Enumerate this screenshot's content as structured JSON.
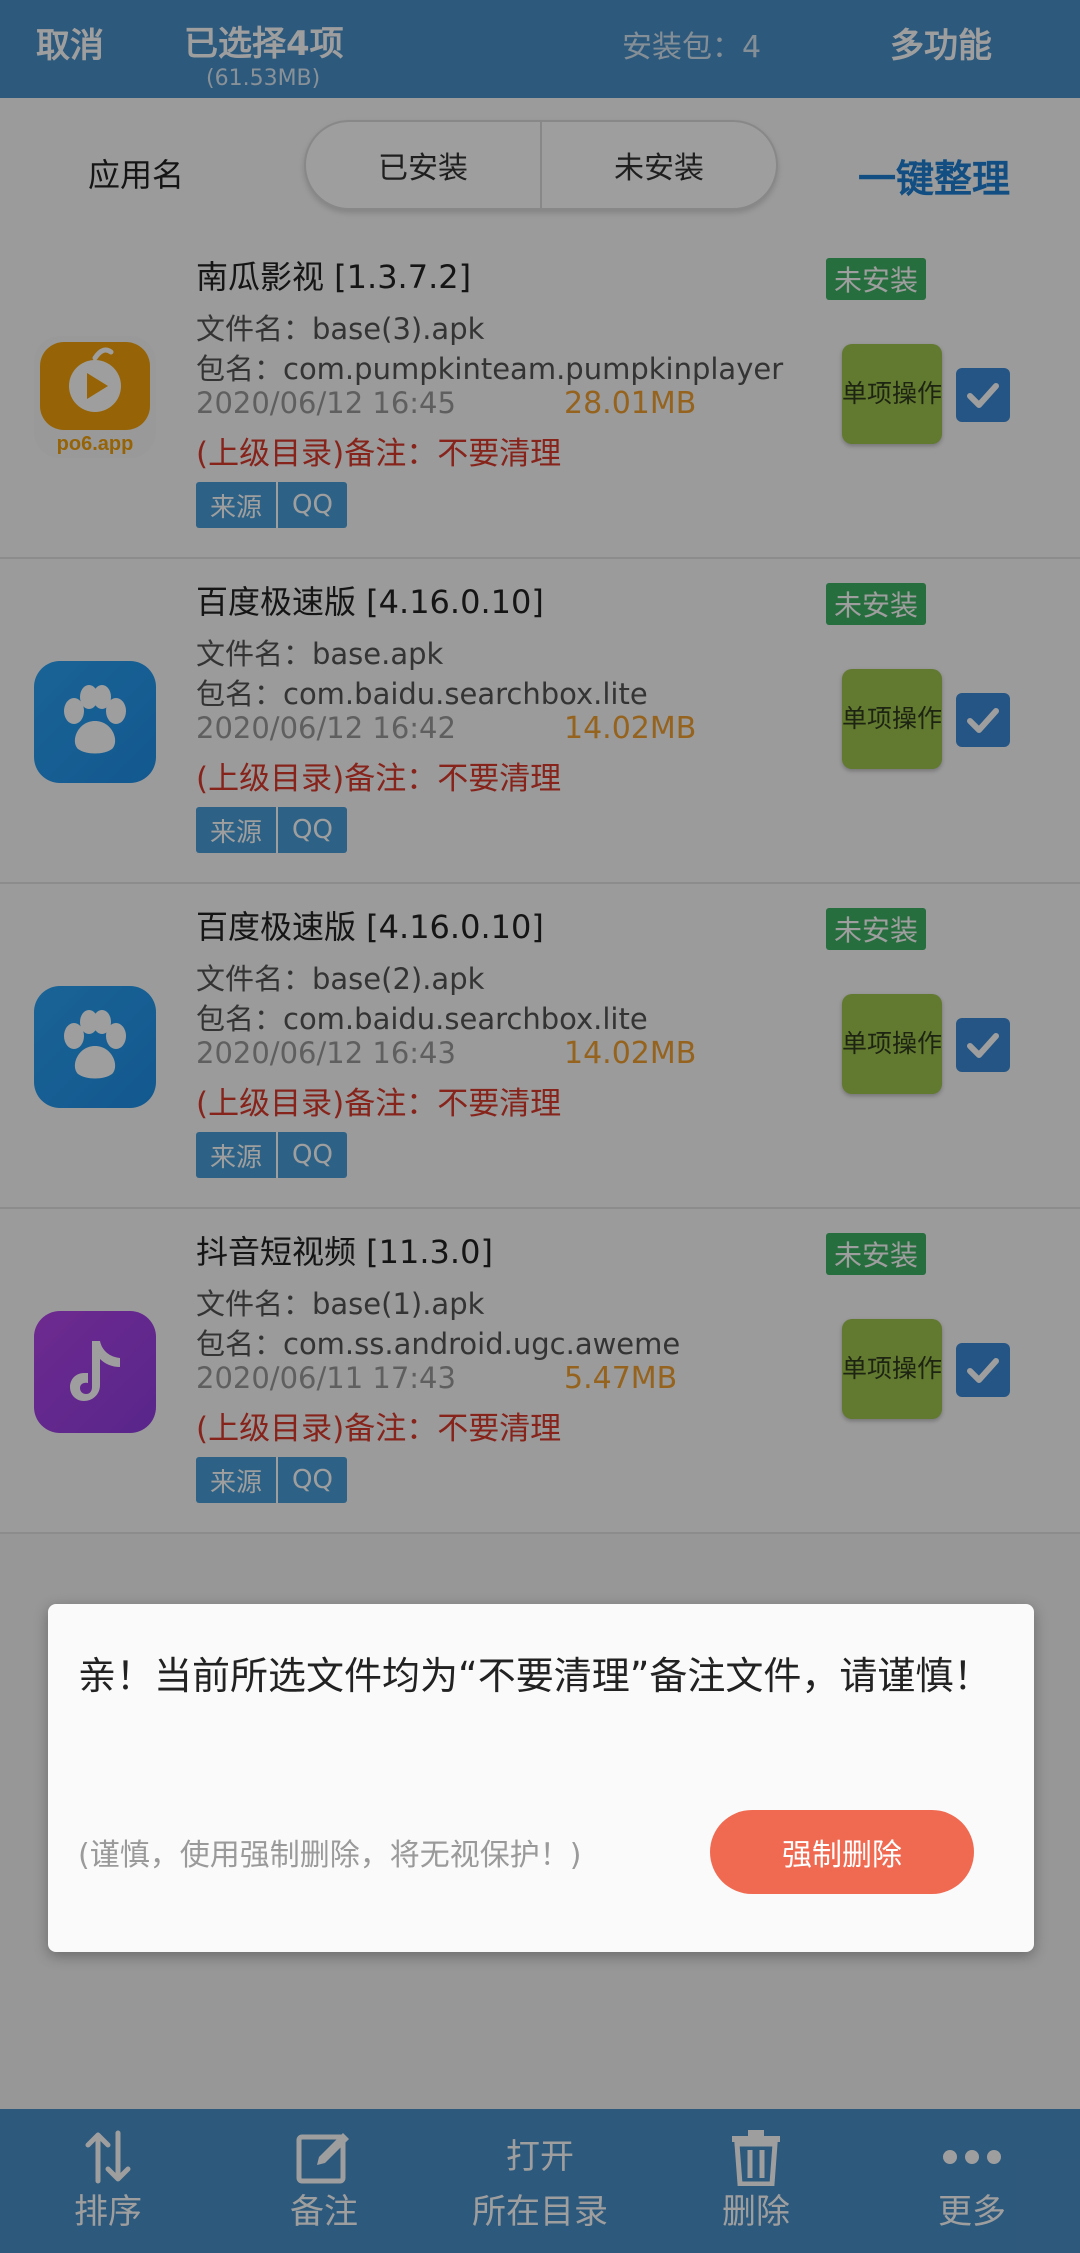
{
  "topbar": {
    "cancel": "取消",
    "selected": "已选择4项",
    "selected_size": "(61.53MB)",
    "package_count": "安装包：4",
    "multi_function": "多功能"
  },
  "filter": {
    "app_name_label": "应用名",
    "tabs": [
      "已安装",
      "未安装"
    ],
    "organize": "一键整理"
  },
  "items": [
    {
      "title": "南瓜影视 [1.3.7.2]",
      "file_name": "文件名：base(3).apk",
      "package": "包名：com.pumpkinteam.pumpkinplayer",
      "date": "2020/06/12 16:45",
      "size": "28.01MB",
      "note": "(上级目录)备注：不要清理",
      "source_label": "来源",
      "source_value": "QQ",
      "status": "未安装",
      "action": "单项操作",
      "icon": "pumpkin-video-icon",
      "icon_text": "po6.app",
      "checked": true
    },
    {
      "title": "百度极速版 [4.16.0.10]",
      "file_name": "文件名：base.apk",
      "package": "包名：com.baidu.searchbox.lite",
      "date": "2020/06/12 16:42",
      "size": "14.02MB",
      "note": "(上级目录)备注：不要清理",
      "source_label": "来源",
      "source_value": "QQ",
      "status": "未安装",
      "action": "单项操作",
      "icon": "baidu-paw-icon",
      "checked": true
    },
    {
      "title": "百度极速版 [4.16.0.10]",
      "file_name": "文件名：base(2).apk",
      "package": "包名：com.baidu.searchbox.lite",
      "date": "2020/06/12 16:43",
      "size": "14.02MB",
      "note": "(上级目录)备注：不要清理",
      "source_label": "来源",
      "source_value": "QQ",
      "status": "未安装",
      "action": "单项操作",
      "icon": "baidu-paw-icon",
      "checked": true
    },
    {
      "title": "抖音短视频 [11.3.0]",
      "file_name": "文件名：base(1).apk",
      "package": "包名：com.ss.android.ugc.aweme",
      "date": "2020/06/11 17:43",
      "size": "5.47MB",
      "note": "(上级目录)备注：不要清理",
      "source_label": "来源",
      "source_value": "QQ",
      "status": "未安装",
      "action": "单项操作",
      "icon": "douyin-icon",
      "checked": true
    }
  ],
  "dialog": {
    "message": "亲！当前所选文件均为“不要清理”备注文件，请谨慎！",
    "hint": "(谨慎，使用强制删除，将无视保护！)",
    "force_delete": "强制删除"
  },
  "bottom_nav": [
    {
      "icon": "sort-icon",
      "label": "排序"
    },
    {
      "icon": "edit-note-icon",
      "label": "备注"
    },
    {
      "icon_text": "打开",
      "label": "所在目录"
    },
    {
      "icon": "trash-icon",
      "label": "删除"
    },
    {
      "icon": "more-dots-icon",
      "label": "更多"
    }
  ],
  "colors": {
    "primary": "#4a90c8",
    "accent_blue": "#1e7fd0",
    "installed_badge": "#3fb265",
    "size_orange": "#f0a030",
    "note_red": "#d83a2e",
    "force_button": "#f06a52"
  }
}
